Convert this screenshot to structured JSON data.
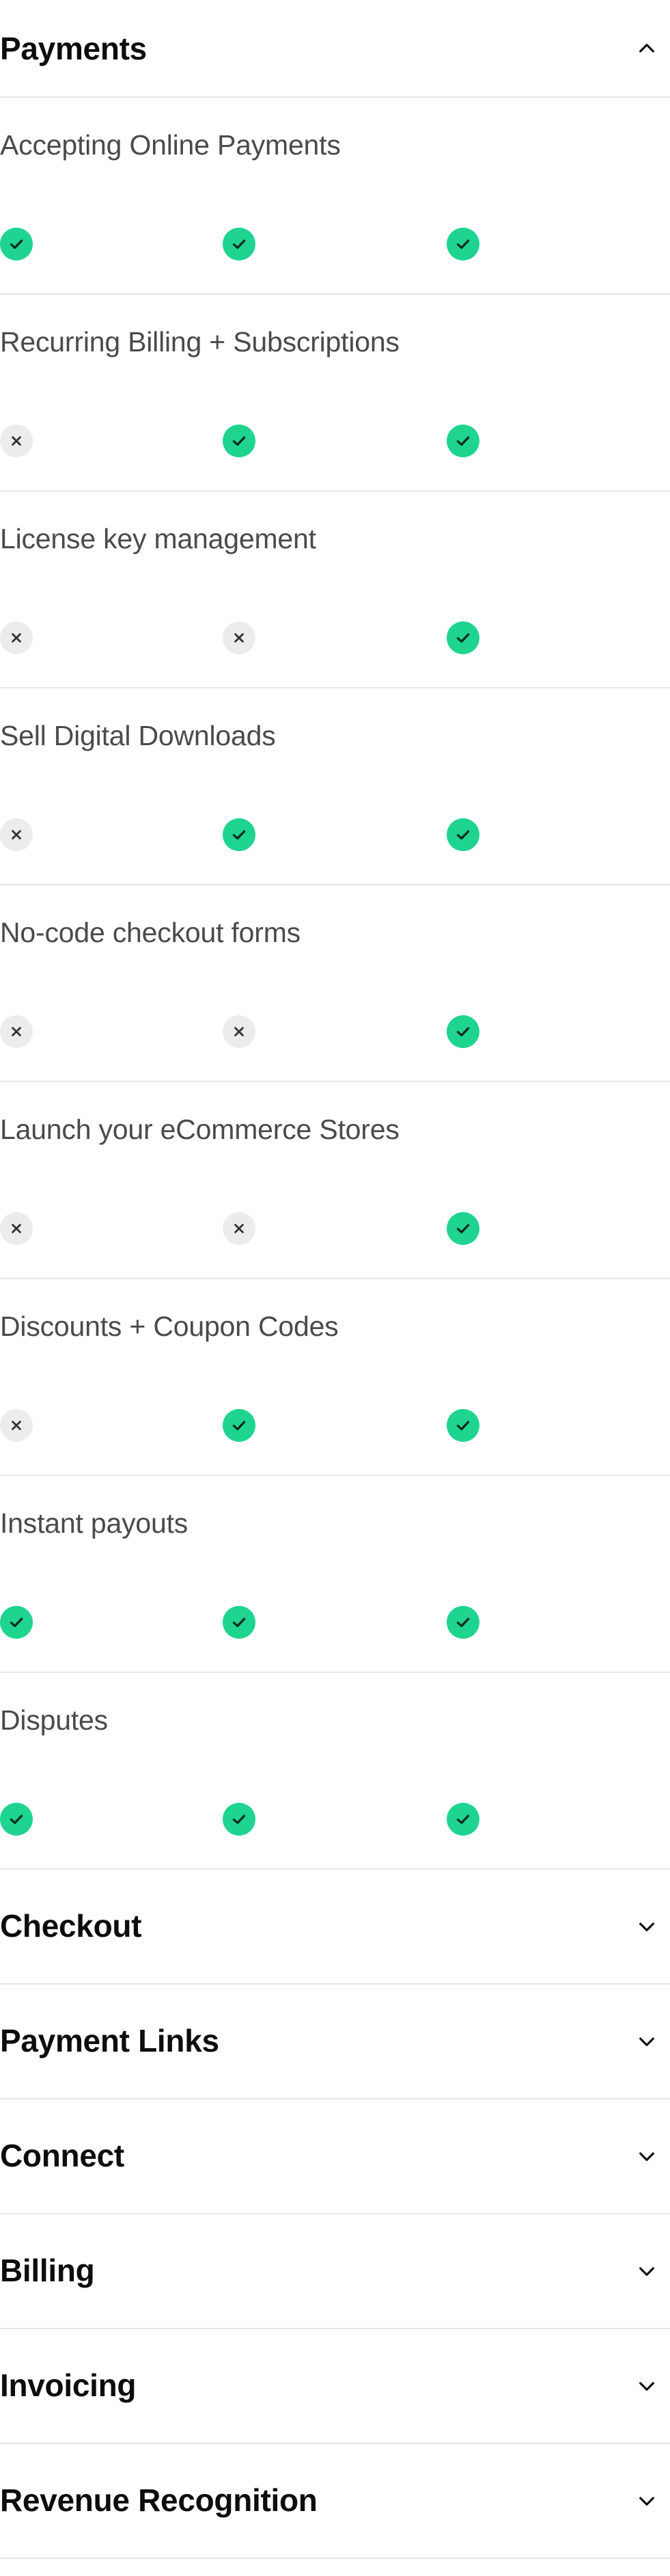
{
  "expanded_section": {
    "title": "Payments",
    "chevron_icon": "chevron-up-icon",
    "features": [
      {
        "label": "Accepting Online Payments",
        "plans": [
          true,
          true,
          true
        ]
      },
      {
        "label": "Recurring Billing + Subscriptions",
        "plans": [
          false,
          true,
          true
        ]
      },
      {
        "label": "License key management",
        "plans": [
          false,
          false,
          true
        ]
      },
      {
        "label": "Sell Digital Downloads",
        "plans": [
          false,
          true,
          true
        ]
      },
      {
        "label": "No-code checkout forms",
        "plans": [
          false,
          false,
          true
        ]
      },
      {
        "label": "Launch your eCommerce Stores",
        "plans": [
          false,
          false,
          true
        ]
      },
      {
        "label": "Discounts + Coupon Codes",
        "plans": [
          false,
          true,
          true
        ]
      },
      {
        "label": "Instant payouts",
        "plans": [
          true,
          true,
          true
        ]
      },
      {
        "label": "Disputes",
        "plans": [
          true,
          true,
          true
        ]
      }
    ]
  },
  "collapsed_sections": [
    {
      "title": "Checkout",
      "chevron_icon": "chevron-down-icon"
    },
    {
      "title": "Payment Links",
      "chevron_icon": "chevron-down-icon"
    },
    {
      "title": "Connect",
      "chevron_icon": "chevron-down-icon"
    },
    {
      "title": "Billing",
      "chevron_icon": "chevron-down-icon"
    },
    {
      "title": "Invoicing",
      "chevron_icon": "chevron-down-icon"
    },
    {
      "title": "Revenue Recognition",
      "chevron_icon": "chevron-down-icon"
    }
  ],
  "colors": {
    "included": "#1ed48f",
    "not_included": "#ececec",
    "divider": "#e6e6e6",
    "title": "#0d0d0d",
    "feature_text": "#4a4a4a"
  }
}
